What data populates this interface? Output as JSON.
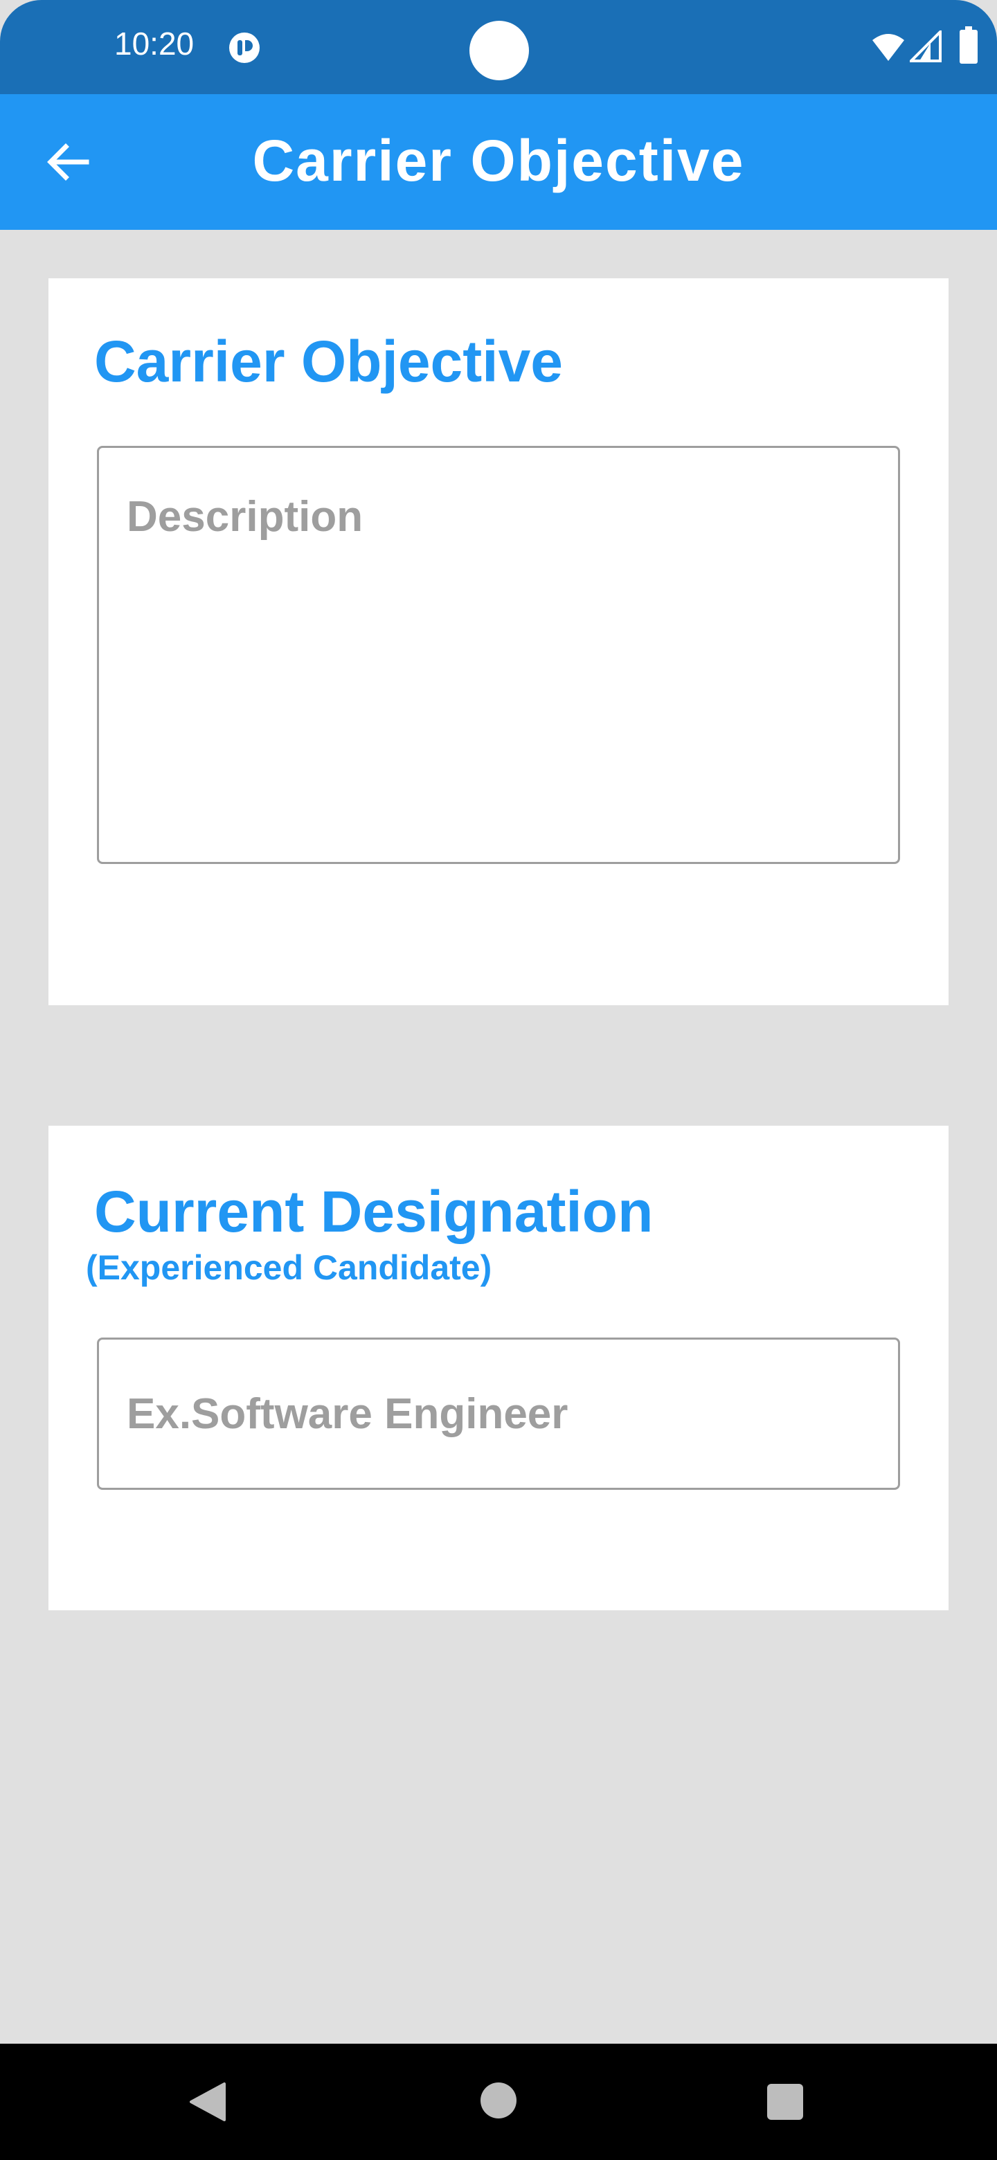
{
  "status_bar": {
    "time": "10:20",
    "icons": [
      "app-notification-icon",
      "wifi-icon",
      "signal-icon",
      "battery-icon"
    ]
  },
  "app_bar": {
    "title": "Carrier Objective",
    "back_icon": "arrow-back-icon"
  },
  "sections": {
    "objective": {
      "heading": "Carrier Objective",
      "placeholder": "Description",
      "value": ""
    },
    "designation": {
      "heading": "Current Designation",
      "subheading": "(Experienced Candidate)",
      "placeholder": "Ex.Software Engineer",
      "value": ""
    }
  },
  "nav_bar": {
    "icons": [
      "nav-back-icon",
      "nav-home-icon",
      "nav-recents-icon"
    ]
  },
  "colors": {
    "status_bar": "#1A6FB6",
    "app_bar": "#2196F3",
    "accent": "#2196F3",
    "background": "#E0E0E0",
    "placeholder": "#9E9E9E"
  }
}
